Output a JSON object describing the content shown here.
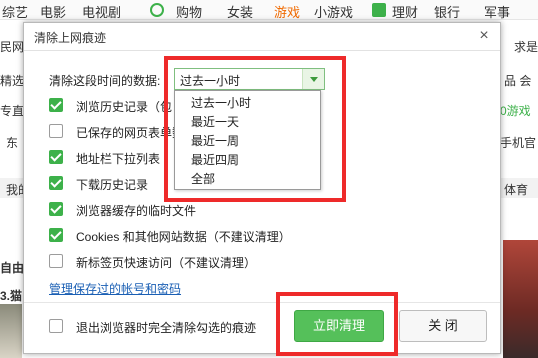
{
  "background": {
    "nav": [
      "综艺",
      "电影",
      "电视剧",
      "购物",
      "女装",
      "游戏",
      "小游戏",
      "理财",
      "银行",
      "军事"
    ],
    "nav_hot_index": 5,
    "left_fragments": [
      "民网",
      "精选",
      "专直播",
      "东",
      "我的",
      "自由",
      "3.猫"
    ],
    "right_fragments": [
      "求是",
      "品 会",
      "0游戏",
      "手机官",
      "体育"
    ]
  },
  "dialog": {
    "title": "清除上网痕迹",
    "range_label": "清除这段时间的数据:",
    "range_value": "过去一小时",
    "range_options": [
      "过去一小时",
      "最近一天",
      "最近一周",
      "最近四周",
      "全部"
    ],
    "items": [
      {
        "label": "浏览历史记录（包",
        "checked": true
      },
      {
        "label": "已保存的网页表单数",
        "checked": false
      },
      {
        "label": "地址栏下拉列表",
        "checked": true
      },
      {
        "label": "下载历史记录",
        "checked": true
      },
      {
        "label": "浏览器缓存的临时文件",
        "checked": true
      },
      {
        "label": "Cookies 和其他网站数据（不建议清理）",
        "checked": true
      },
      {
        "label": "新标签页快速访问（不建议清理）",
        "checked": false
      }
    ],
    "manage_link": "管理保存过的帐号和密码",
    "exit_option": {
      "label": "退出浏览器时完全清除勾选的痕迹",
      "checked": false
    },
    "clear_button": "立即清理",
    "close_button": "关 闭"
  },
  "colors": {
    "accent_green": "#3db14a",
    "button_green": "#55c05a",
    "highlight_red": "#ee2a2a",
    "link_blue": "#1a5fb4"
  }
}
